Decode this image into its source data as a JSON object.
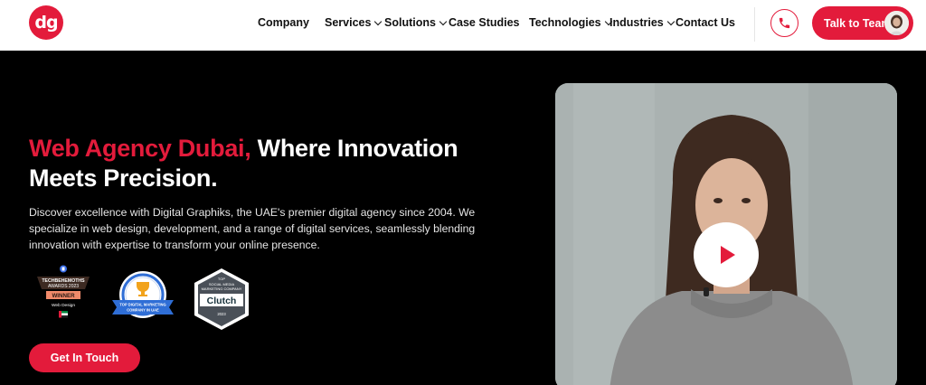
{
  "header": {
    "logo_text": "dg",
    "nav": [
      {
        "label": "Company",
        "has_dropdown": false
      },
      {
        "label": "Services",
        "has_dropdown": true
      },
      {
        "label": "Solutions",
        "has_dropdown": true
      },
      {
        "label": "Case Studies",
        "has_dropdown": false
      },
      {
        "label": "Technologies",
        "has_dropdown": true
      },
      {
        "label": "Industries",
        "has_dropdown": true
      },
      {
        "label": "Contact Us",
        "has_dropdown": false
      }
    ],
    "phone_icon": "phone-icon",
    "cta_label": "Talk to Team"
  },
  "hero": {
    "title_accent": "Web Agency Dubai,",
    "title_rest": " Where Innovation Meets Precision.",
    "description": "Discover excellence with Digital Graphiks, the UAE's premier digital agency since 2004. We specialize in web design, development, and a range of digital services, seamlessly blending innovation with expertise to transform your online presence.",
    "awards": {
      "techbehemoths": {
        "line1": "TECHBEHEMOTHS",
        "line2": "AWARDS 2023",
        "badge": "WINNER",
        "category": "Web Design"
      },
      "top_agency": {
        "text": "TOP DIGITAL MARKETING COMPANY IN UAE"
      },
      "clutch": {
        "top": "TOP",
        "line1": "SOCIAL MEDIA",
        "line2": "MARKETING COMPANY",
        "name": "Clutch",
        "year": "2023"
      }
    },
    "cta_label": "Get In Touch"
  },
  "video": {
    "play_icon": "play-icon"
  },
  "colors": {
    "accent": "#e31b3b",
    "background": "#000000",
    "header_bg": "#ffffff"
  }
}
